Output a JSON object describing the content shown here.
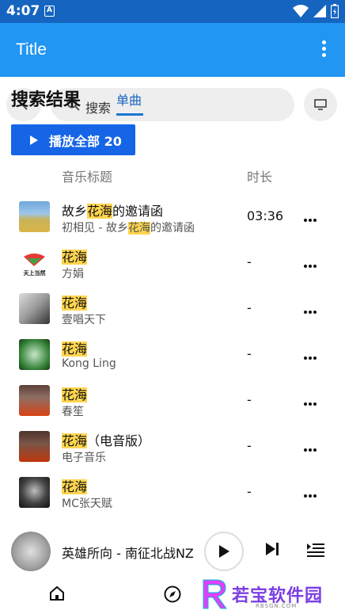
{
  "status_bar": {
    "time": "4:07",
    "notification_icon": "A"
  },
  "app_bar": {
    "title": "Title"
  },
  "search": {
    "title": "搜索结果",
    "label": "搜索",
    "tab": "单曲"
  },
  "play_all": {
    "label": "播放全部 20"
  },
  "table_header": {
    "title": "音乐标题",
    "duration": "时长"
  },
  "songs": [
    {
      "name_pre": "故乡",
      "name_hl": "花海",
      "name_post": "的邀请函",
      "artist_pre": "初相见 - 故乡",
      "artist_hl": "花海",
      "artist_post": "的邀请函",
      "duration": "03:36"
    },
    {
      "name_pre": "",
      "name_hl": "花海",
      "name_post": "",
      "artist_pre": "方娟",
      "artist_hl": "",
      "artist_post": "",
      "duration": "-"
    },
    {
      "name_pre": "",
      "name_hl": "花海",
      "name_post": "",
      "artist_pre": "壹唱天下",
      "artist_hl": "",
      "artist_post": "",
      "duration": "-"
    },
    {
      "name_pre": "",
      "name_hl": "花海",
      "name_post": "",
      "artist_pre": "Kong Ling",
      "artist_hl": "",
      "artist_post": "",
      "duration": "-"
    },
    {
      "name_pre": "",
      "name_hl": "花海",
      "name_post": "",
      "artist_pre": "春笙",
      "artist_hl": "",
      "artist_post": "",
      "duration": "-"
    },
    {
      "name_pre": "",
      "name_hl": "花海",
      "name_post": "（电音版）",
      "artist_pre": "电子音乐",
      "artist_hl": "",
      "artist_post": "",
      "duration": "-"
    },
    {
      "name_pre": "",
      "name_hl": "花海",
      "name_post": "",
      "artist_pre": "MC张天赋",
      "artist_hl": "",
      "artist_post": "",
      "duration": "-"
    }
  ],
  "thumb1_logo_text": "天上当然",
  "player": {
    "song": "英雄所向 - 南征北战NZ"
  },
  "watermark": {
    "text": "若宝软件园",
    "sub": "RBSGN.COM"
  },
  "colors": {
    "status_bar": "#1565c0",
    "app_bar": "#2196f3",
    "accent": "#1565e6",
    "highlight": "#ffd54f"
  }
}
